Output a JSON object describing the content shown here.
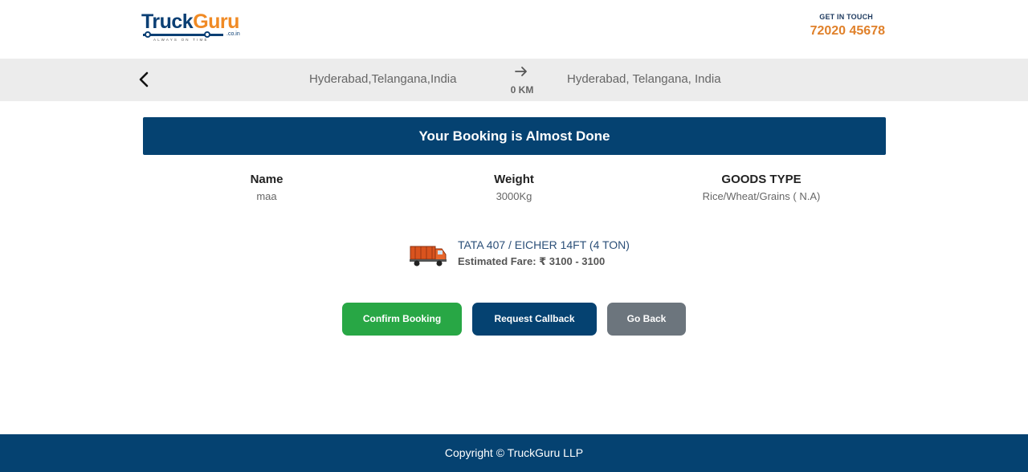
{
  "header": {
    "logo": {
      "truck": "Truck",
      "guru": "Guru",
      "suffix": ".co.in",
      "tagline": "ALWAYS ON TIME"
    },
    "contact_label": "GET IN TOUCH",
    "contact_phone": "72020 45678"
  },
  "route": {
    "from": "Hyderabad,Telangana,India",
    "to": "Hyderabad, Telangana, India",
    "distance": "0 KM"
  },
  "banner": {
    "title": "Your Booking is Almost Done"
  },
  "details": [
    {
      "label": "Name",
      "value": "maa"
    },
    {
      "label": "Weight",
      "value": "3000Kg"
    },
    {
      "label": "GOODS TYPE",
      "value": "Rice/Wheat/Grains ( N.A)"
    }
  ],
  "vehicle": {
    "name": "TATA 407 / EICHER 14FT (4 TON)",
    "fare": "Estimated Fare: ₹ 3100 - 3100"
  },
  "actions": {
    "confirm": "Confirm Booking",
    "callback": "Request Callback",
    "back": "Go Back"
  },
  "footer": {
    "copyright": "Copyright © TruckGuru LLP"
  },
  "colors": {
    "primary": "#054271",
    "accent": "#e0812b",
    "success": "#28a745",
    "secondary": "#6c757d"
  }
}
